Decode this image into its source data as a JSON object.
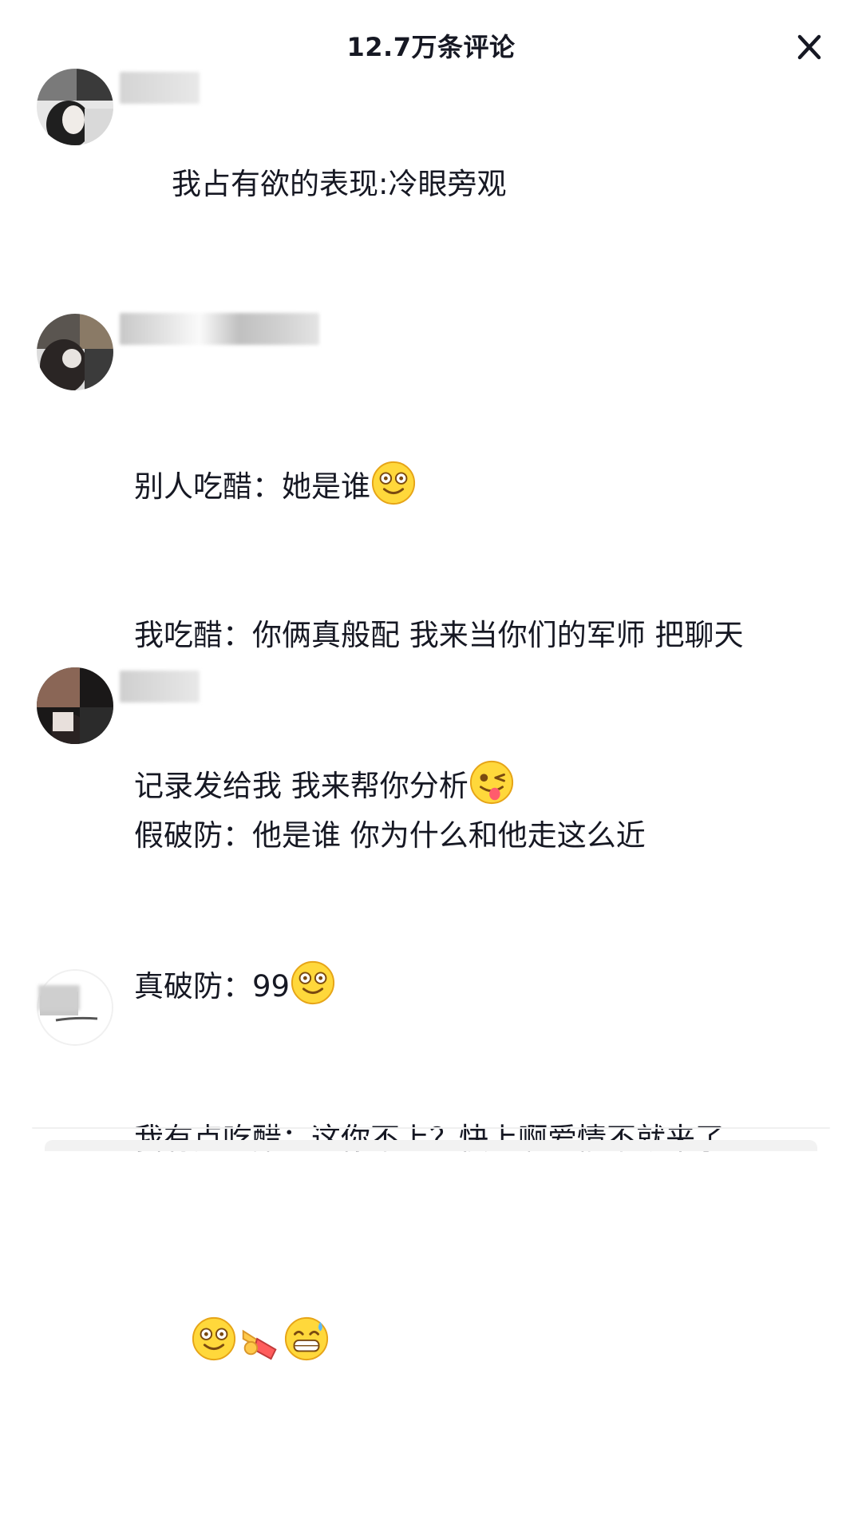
{
  "header": {
    "title": "12.7万条评论",
    "close_icon": "close-icon"
  },
  "comments": [
    {
      "avatar_icon": "user-avatar",
      "text": "我占有欲的表现:冷眼旁观",
      "emojis": []
    },
    {
      "avatar_icon": "user-avatar",
      "lines": [
        "别人吃醋：她是谁",
        "我吃醋：你俩真般配 我来当你们的军师 把聊天",
        "记录发给我 我来帮你分析"
      ],
      "emojis": [
        "dizzy-smile-emoji",
        "wink-tongue-emoji"
      ]
    },
    {
      "avatar_icon": "user-avatar",
      "lines": [
        "假破防：他是谁 你为什么和他走这么近",
        "真破防：99"
      ],
      "emojis": [
        "dizzy-smile-emoji"
      ]
    },
    {
      "avatar_icon": "user-avatar",
      "text": "我有点吃醋：这你不上？快上啊爱情不就来了",
      "emojis": [
        "dizzy-smile-emoji",
        "pointing-hand-emoji",
        "sweat-grin-emoji"
      ]
    }
  ]
}
